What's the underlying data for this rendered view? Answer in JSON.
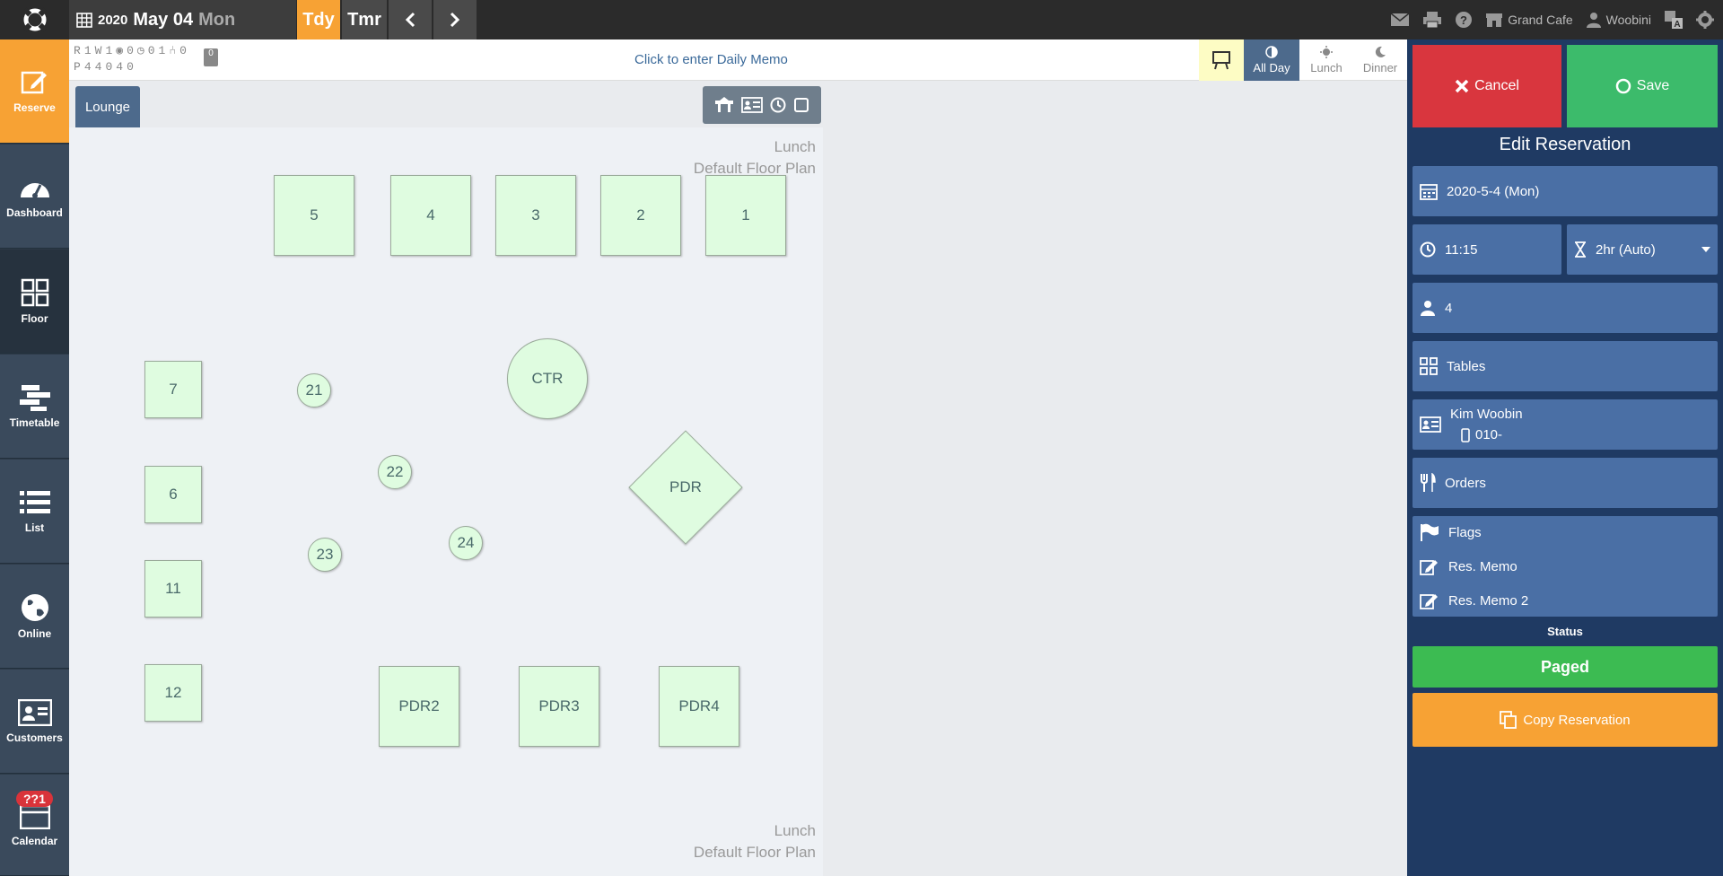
{
  "topbar": {
    "year": "2020",
    "month_day": "May 04",
    "weekday": "Mon",
    "today_label": "Tdy",
    "tomorrow_label": "Tmr",
    "restaurant": "Grand Cafe",
    "user": "Woobini"
  },
  "sidebar": {
    "items": [
      {
        "label": "Reserve",
        "icon": "edit-icon"
      },
      {
        "label": "Dashboard",
        "icon": "gauge-icon"
      },
      {
        "label": "Floor",
        "icon": "grid-icon"
      },
      {
        "label": "Timetable",
        "icon": "timetable-icon"
      },
      {
        "label": "List",
        "icon": "list-icon"
      },
      {
        "label": "Online",
        "icon": "globe-icon"
      },
      {
        "label": "Customers",
        "icon": "id-card-icon"
      },
      {
        "label": "Calendar",
        "icon": "calendar-icon"
      }
    ],
    "calendar_badge": "??1"
  },
  "infostrip": {
    "r_row": [
      "R",
      "1",
      "W",
      "1",
      "0",
      "0",
      "1",
      "0"
    ],
    "p_row": [
      "P",
      "4",
      "4",
      "0",
      "4",
      "0"
    ],
    "memo_badge": "0",
    "memo_link": "Click to enter Daily Memo",
    "views": {
      "allday": "All Day",
      "lunch": "Lunch",
      "dinner": "Dinner"
    }
  },
  "floor": {
    "tab": "Lounge",
    "plan_top_line1": "Lunch",
    "plan_top_line2": "Default Floor Plan",
    "plan_bottom_line1": "Lunch",
    "plan_bottom_line2": "Default Floor Plan",
    "tables": {
      "t5": "5",
      "t4": "4",
      "t3": "3",
      "t2": "2",
      "t1": "1",
      "t7": "7",
      "t6": "6",
      "t11": "11",
      "t12": "12",
      "t21": "21",
      "t22": "22",
      "t23": "23",
      "t24": "24",
      "ctr": "CTR",
      "pdr": "PDR",
      "pdr2": "PDR2",
      "pdr3": "PDR3",
      "pdr4": "PDR4"
    }
  },
  "panel": {
    "cancel": "Cancel",
    "save": "Save",
    "title": "Edit Reservation",
    "date": "2020-5-4 (Mon)",
    "time": "11:15",
    "duration": "2hr (Auto)",
    "party": "4",
    "tables": "Tables",
    "customer_name": "Kim Woobin",
    "customer_phone": "010-",
    "orders": "Orders",
    "flags": "Flags",
    "memo1": "Res. Memo",
    "memo2": "Res. Memo 2",
    "status_label": "Status",
    "status": "Paged",
    "copy": "Copy Reservation"
  }
}
